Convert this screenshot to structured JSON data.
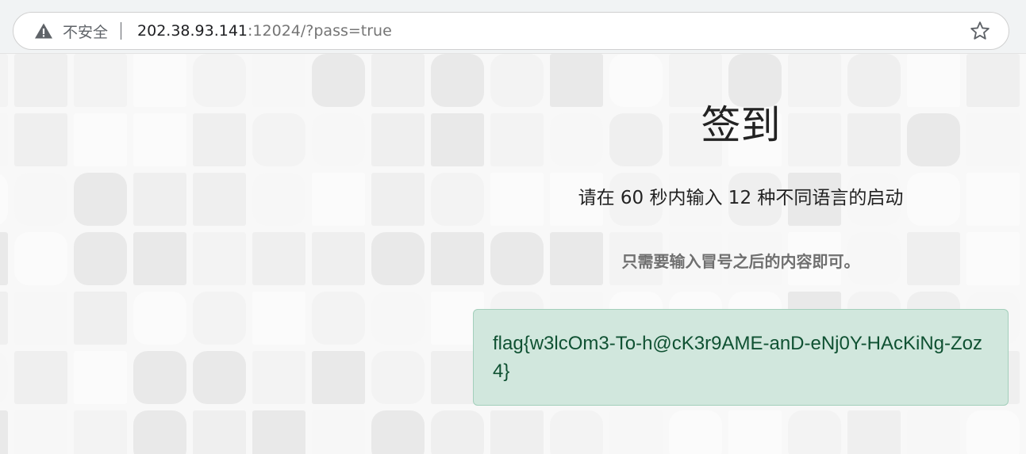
{
  "browser": {
    "security_label": "不安全",
    "url_host": "202.38.93.141",
    "url_rest": ":12024/?pass=true",
    "icons": {
      "security": "warning-icon",
      "bookmark": "star-icon"
    }
  },
  "page": {
    "title": "签到",
    "subtitle": "请在 60 秒内输入 12 种不同语言的启动",
    "hint": "只需要输入冒号之后的内容即可。",
    "flag_alert": {
      "text": "flag{w3lcOm3-To-h@cK3r9AME-anD-eNj0Y-HAcKiNg-Zoz4}"
    }
  },
  "colors": {
    "alert_background": "#d1e7dd",
    "alert_border": "#a3cfbb",
    "alert_text": "#0f5132",
    "background_tiles": [
      "#e9e9e9",
      "#efefef",
      "#f3f3f3",
      "#f7f7f7",
      "#fbfbfb"
    ]
  }
}
